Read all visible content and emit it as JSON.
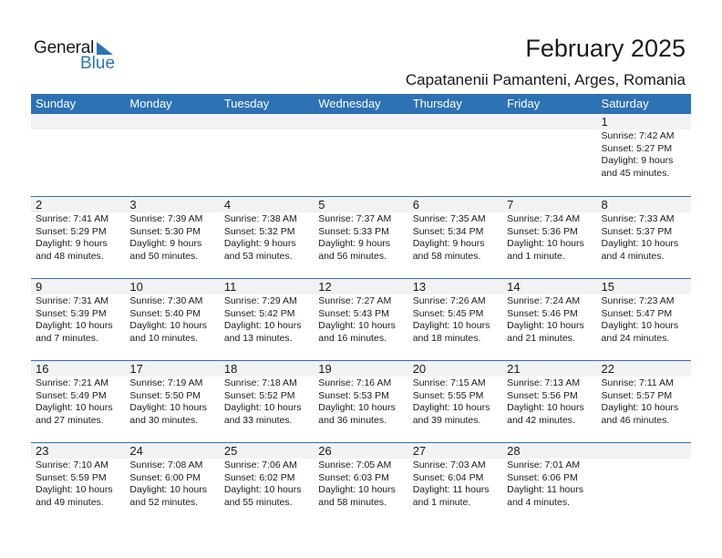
{
  "logo": {
    "word1": "General",
    "word2": "Blue"
  },
  "header": {
    "title": "February 2025",
    "location": "Capatanenii Pamanteni, Arges, Romania"
  },
  "colors": {
    "accent": "#2d72b5",
    "daynum_bg": "#f2f2f2"
  },
  "weekdays": [
    "Sunday",
    "Monday",
    "Tuesday",
    "Wednesday",
    "Thursday",
    "Friday",
    "Saturday"
  ],
  "weeks": [
    [
      {
        "day": "",
        "sunrise": "",
        "sunset": "",
        "daylight": "",
        "minutes": ""
      },
      {
        "day": "",
        "sunrise": "",
        "sunset": "",
        "daylight": "",
        "minutes": ""
      },
      {
        "day": "",
        "sunrise": "",
        "sunset": "",
        "daylight": "",
        "minutes": ""
      },
      {
        "day": "",
        "sunrise": "",
        "sunset": "",
        "daylight": "",
        "minutes": ""
      },
      {
        "day": "",
        "sunrise": "",
        "sunset": "",
        "daylight": "",
        "minutes": ""
      },
      {
        "day": "",
        "sunrise": "",
        "sunset": "",
        "daylight": "",
        "minutes": ""
      },
      {
        "day": "1",
        "sunrise": "Sunrise: 7:42 AM",
        "sunset": "Sunset: 5:27 PM",
        "daylight": "Daylight: 9 hours",
        "minutes": "and 45 minutes."
      }
    ],
    [
      {
        "day": "2",
        "sunrise": "Sunrise: 7:41 AM",
        "sunset": "Sunset: 5:29 PM",
        "daylight": "Daylight: 9 hours",
        "minutes": "and 48 minutes."
      },
      {
        "day": "3",
        "sunrise": "Sunrise: 7:39 AM",
        "sunset": "Sunset: 5:30 PM",
        "daylight": "Daylight: 9 hours",
        "minutes": "and 50 minutes."
      },
      {
        "day": "4",
        "sunrise": "Sunrise: 7:38 AM",
        "sunset": "Sunset: 5:32 PM",
        "daylight": "Daylight: 9 hours",
        "minutes": "and 53 minutes."
      },
      {
        "day": "5",
        "sunrise": "Sunrise: 7:37 AM",
        "sunset": "Sunset: 5:33 PM",
        "daylight": "Daylight: 9 hours",
        "minutes": "and 56 minutes."
      },
      {
        "day": "6",
        "sunrise": "Sunrise: 7:35 AM",
        "sunset": "Sunset: 5:34 PM",
        "daylight": "Daylight: 9 hours",
        "minutes": "and 58 minutes."
      },
      {
        "day": "7",
        "sunrise": "Sunrise: 7:34 AM",
        "sunset": "Sunset: 5:36 PM",
        "daylight": "Daylight: 10 hours",
        "minutes": "and 1 minute."
      },
      {
        "day": "8",
        "sunrise": "Sunrise: 7:33 AM",
        "sunset": "Sunset: 5:37 PM",
        "daylight": "Daylight: 10 hours",
        "minutes": "and 4 minutes."
      }
    ],
    [
      {
        "day": "9",
        "sunrise": "Sunrise: 7:31 AM",
        "sunset": "Sunset: 5:39 PM",
        "daylight": "Daylight: 10 hours",
        "minutes": "and 7 minutes."
      },
      {
        "day": "10",
        "sunrise": "Sunrise: 7:30 AM",
        "sunset": "Sunset: 5:40 PM",
        "daylight": "Daylight: 10 hours",
        "minutes": "and 10 minutes."
      },
      {
        "day": "11",
        "sunrise": "Sunrise: 7:29 AM",
        "sunset": "Sunset: 5:42 PM",
        "daylight": "Daylight: 10 hours",
        "minutes": "and 13 minutes."
      },
      {
        "day": "12",
        "sunrise": "Sunrise: 7:27 AM",
        "sunset": "Sunset: 5:43 PM",
        "daylight": "Daylight: 10 hours",
        "minutes": "and 16 minutes."
      },
      {
        "day": "13",
        "sunrise": "Sunrise: 7:26 AM",
        "sunset": "Sunset: 5:45 PM",
        "daylight": "Daylight: 10 hours",
        "minutes": "and 18 minutes."
      },
      {
        "day": "14",
        "sunrise": "Sunrise: 7:24 AM",
        "sunset": "Sunset: 5:46 PM",
        "daylight": "Daylight: 10 hours",
        "minutes": "and 21 minutes."
      },
      {
        "day": "15",
        "sunrise": "Sunrise: 7:23 AM",
        "sunset": "Sunset: 5:47 PM",
        "daylight": "Daylight: 10 hours",
        "minutes": "and 24 minutes."
      }
    ],
    [
      {
        "day": "16",
        "sunrise": "Sunrise: 7:21 AM",
        "sunset": "Sunset: 5:49 PM",
        "daylight": "Daylight: 10 hours",
        "minutes": "and 27 minutes."
      },
      {
        "day": "17",
        "sunrise": "Sunrise: 7:19 AM",
        "sunset": "Sunset: 5:50 PM",
        "daylight": "Daylight: 10 hours",
        "minutes": "and 30 minutes."
      },
      {
        "day": "18",
        "sunrise": "Sunrise: 7:18 AM",
        "sunset": "Sunset: 5:52 PM",
        "daylight": "Daylight: 10 hours",
        "minutes": "and 33 minutes."
      },
      {
        "day": "19",
        "sunrise": "Sunrise: 7:16 AM",
        "sunset": "Sunset: 5:53 PM",
        "daylight": "Daylight: 10 hours",
        "minutes": "and 36 minutes."
      },
      {
        "day": "20",
        "sunrise": "Sunrise: 7:15 AM",
        "sunset": "Sunset: 5:55 PM",
        "daylight": "Daylight: 10 hours",
        "minutes": "and 39 minutes."
      },
      {
        "day": "21",
        "sunrise": "Sunrise: 7:13 AM",
        "sunset": "Sunset: 5:56 PM",
        "daylight": "Daylight: 10 hours",
        "minutes": "and 42 minutes."
      },
      {
        "day": "22",
        "sunrise": "Sunrise: 7:11 AM",
        "sunset": "Sunset: 5:57 PM",
        "daylight": "Daylight: 10 hours",
        "minutes": "and 46 minutes."
      }
    ],
    [
      {
        "day": "23",
        "sunrise": "Sunrise: 7:10 AM",
        "sunset": "Sunset: 5:59 PM",
        "daylight": "Daylight: 10 hours",
        "minutes": "and 49 minutes."
      },
      {
        "day": "24",
        "sunrise": "Sunrise: 7:08 AM",
        "sunset": "Sunset: 6:00 PM",
        "daylight": "Daylight: 10 hours",
        "minutes": "and 52 minutes."
      },
      {
        "day": "25",
        "sunrise": "Sunrise: 7:06 AM",
        "sunset": "Sunset: 6:02 PM",
        "daylight": "Daylight: 10 hours",
        "minutes": "and 55 minutes."
      },
      {
        "day": "26",
        "sunrise": "Sunrise: 7:05 AM",
        "sunset": "Sunset: 6:03 PM",
        "daylight": "Daylight: 10 hours",
        "minutes": "and 58 minutes."
      },
      {
        "day": "27",
        "sunrise": "Sunrise: 7:03 AM",
        "sunset": "Sunset: 6:04 PM",
        "daylight": "Daylight: 11 hours",
        "minutes": "and 1 minute."
      },
      {
        "day": "28",
        "sunrise": "Sunrise: 7:01 AM",
        "sunset": "Sunset: 6:06 PM",
        "daylight": "Daylight: 11 hours",
        "minutes": "and 4 minutes."
      },
      {
        "day": "",
        "sunrise": "",
        "sunset": "",
        "daylight": "",
        "minutes": ""
      }
    ]
  ]
}
